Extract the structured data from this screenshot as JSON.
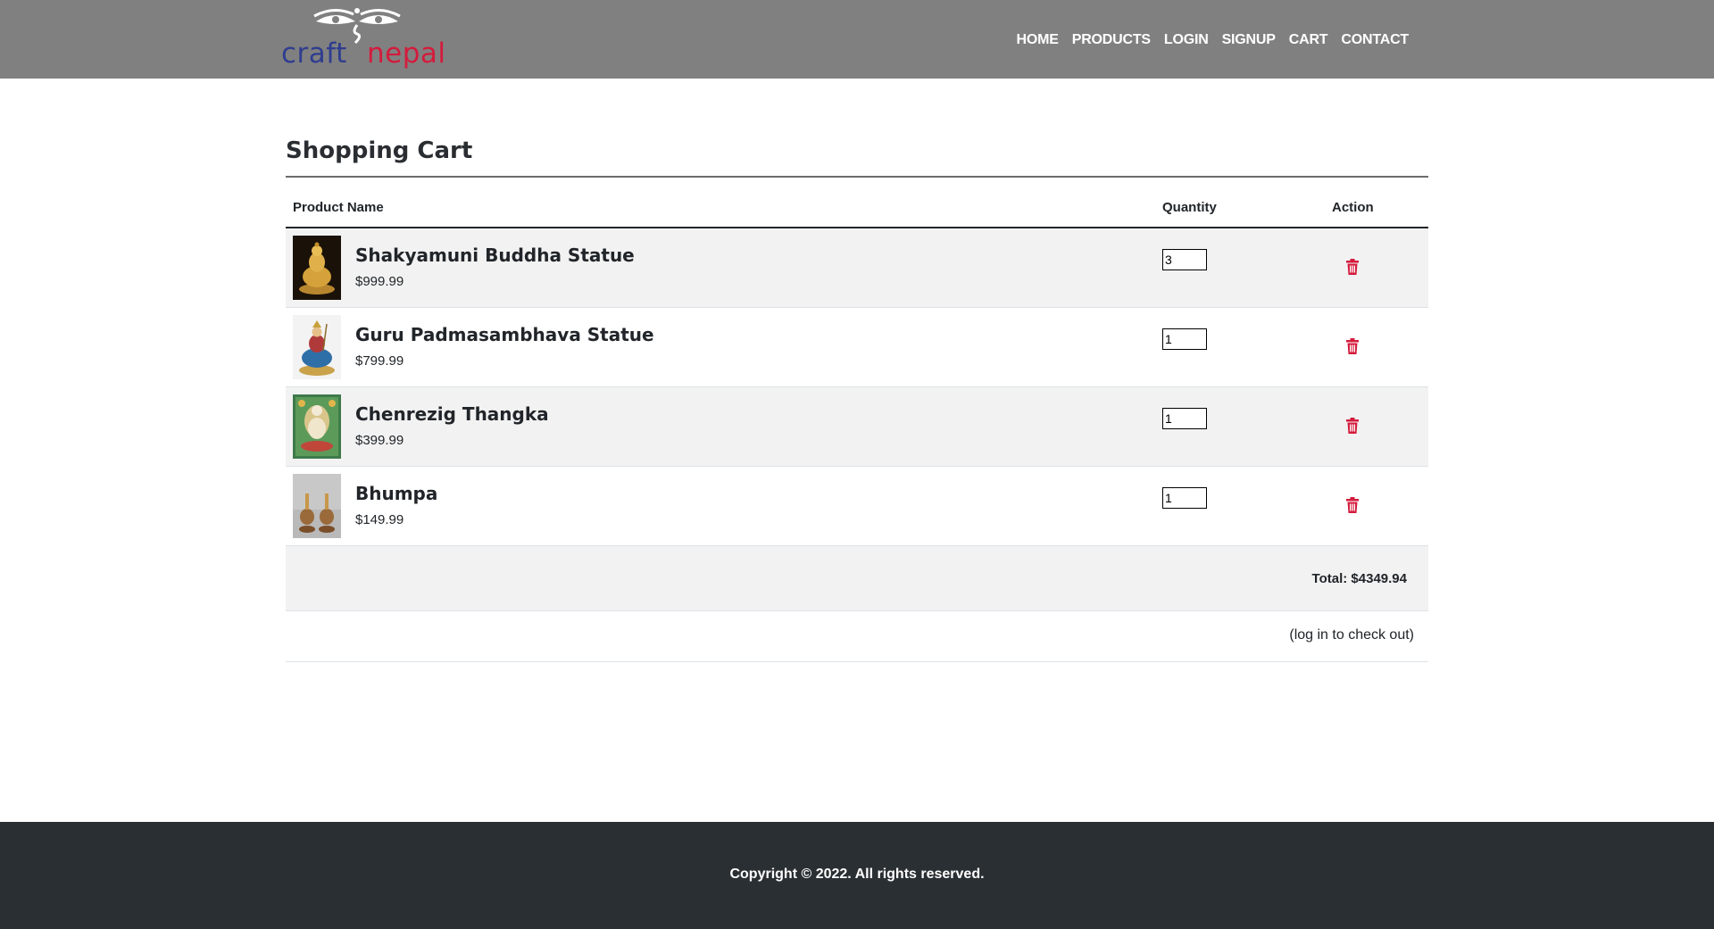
{
  "brand": {
    "logo_left": "craft",
    "logo_right": "nepal",
    "colors": {
      "left": "#2f3d8f",
      "right": "#d41b3c"
    }
  },
  "nav": [
    {
      "label": "HOME"
    },
    {
      "label": "PRODUCTS"
    },
    {
      "label": "LOGIN"
    },
    {
      "label": "SIGNUP"
    },
    {
      "label": "CART"
    },
    {
      "label": "CONTACT"
    }
  ],
  "cart": {
    "title": "Shopping Cart",
    "headers": {
      "name": "Product Name",
      "quantity": "Quantity",
      "action": "Action"
    },
    "items": [
      {
        "name": "Shakyamuni Buddha Statue",
        "price": "$999.99",
        "quantity": "3",
        "thumb": "buddha-statue"
      },
      {
        "name": "Guru Padmasambhava Statue",
        "price": "$799.99",
        "quantity": "1",
        "thumb": "padmasambhava-statue"
      },
      {
        "name": "Chenrezig Thangka",
        "price": "$399.99",
        "quantity": "1",
        "thumb": "chenrezig-thangka"
      },
      {
        "name": "Bhumpa",
        "price": "$149.99",
        "quantity": "1",
        "thumb": "bhumpa-vessels"
      }
    ],
    "total": "Total: $4349.94",
    "checkout_note": "(log in to check out)"
  },
  "action_icon": "trash-icon",
  "accent_color": "#d41b3c",
  "footer": {
    "copyright": "Copyright © 2022. All rights reserved."
  }
}
